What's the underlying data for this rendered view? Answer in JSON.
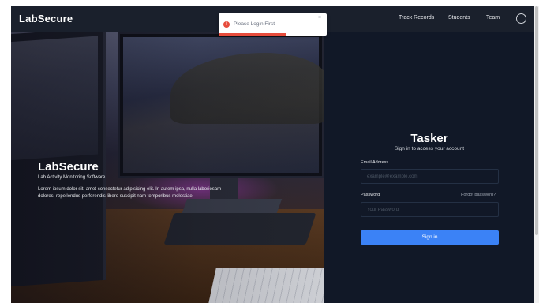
{
  "navbar": {
    "brand": "LabSecure",
    "links": [
      "Track Records",
      "Students",
      "Team"
    ]
  },
  "hero": {
    "brand": "LabSecure",
    "tagline": "Lab Activity Monitoring Software",
    "description": "Lorem ipsum dolor sit, amet consectetur adipisicing elit. In autem ipsa, nulla laboriosam dolores, repellendus perferendis libero suscipit nam temporibus molestiae"
  },
  "login": {
    "title": "Tasker",
    "subtitle": "Sign in to access your account",
    "email_label": "Email Address",
    "email_placeholder": "example@example.com",
    "password_label": "Password",
    "forgot_label": "Forgot password?",
    "password_placeholder": "Your Password",
    "submit_label": "Sign in"
  },
  "toast": {
    "message": "Please Login First",
    "icon": "error-icon",
    "close": "×",
    "icon_glyph": "!"
  },
  "colors": {
    "accent": "#3b82f6",
    "error": "#e74c3c",
    "background": "#111827"
  }
}
